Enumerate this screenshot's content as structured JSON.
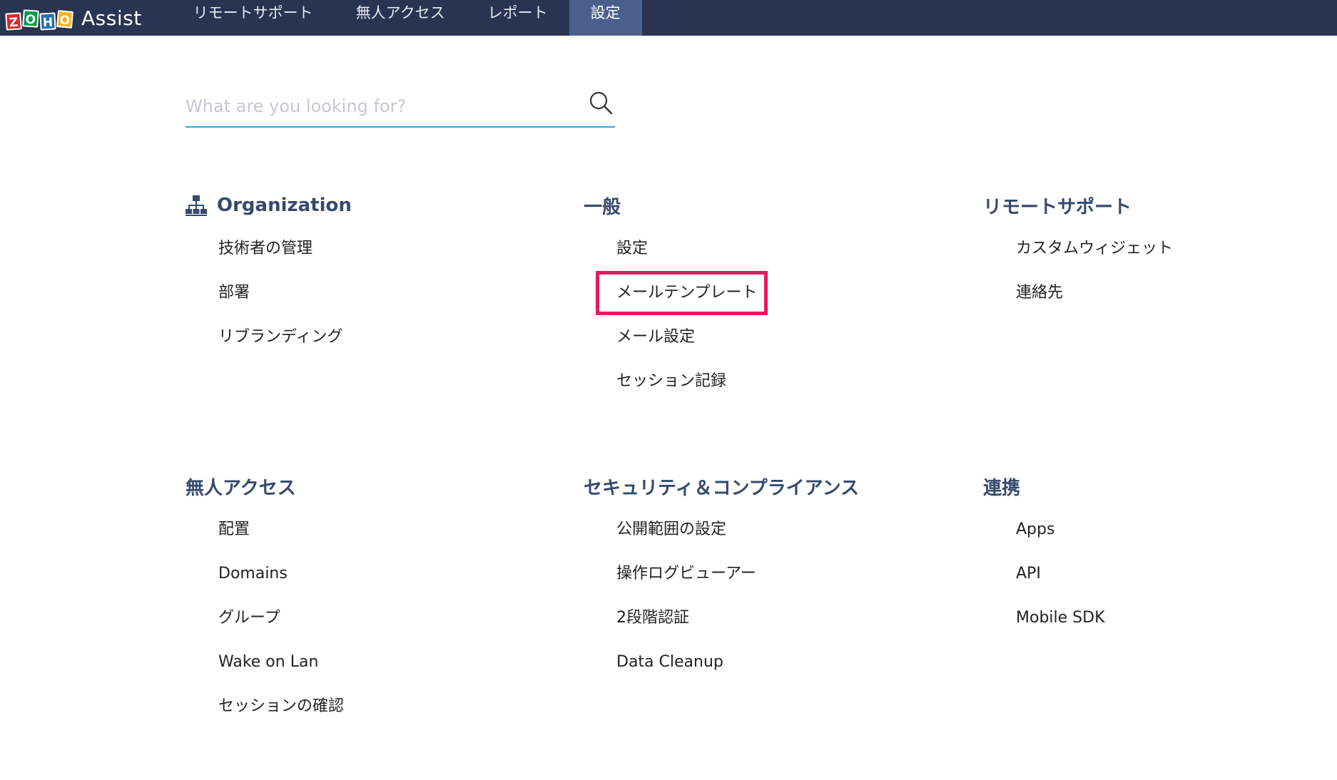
{
  "header": {
    "logo_letters": [
      "Z",
      "O",
      "H",
      "O"
    ],
    "product": "Assist",
    "tabs": [
      {
        "label": "リモートサポート",
        "active": false
      },
      {
        "label": "無人アクセス",
        "active": false
      },
      {
        "label": "レポート",
        "active": false
      },
      {
        "label": "設定",
        "active": true
      }
    ]
  },
  "search": {
    "placeholder": "What are you looking for?",
    "value": ""
  },
  "sections": {
    "organization": {
      "title": "Organization",
      "icon": "org-chart-icon",
      "items": [
        "技術者の管理",
        "部署",
        "リブランディング"
      ]
    },
    "general": {
      "title": "一般",
      "items": [
        "設定",
        "メールテンプレート",
        "メール設定",
        "セッション記録"
      ]
    },
    "remote_support": {
      "title": "リモートサポート",
      "items": [
        "カスタムウィジェット",
        "連絡先"
      ]
    },
    "unattended": {
      "title": "無人アクセス",
      "items": [
        "配置",
        "Domains",
        "グループ",
        "Wake on Lan",
        "セッションの確認"
      ]
    },
    "security": {
      "title": "セキュリティ＆コンプライアンス",
      "items": [
        "公開範囲の設定",
        "操作ログビューアー",
        "2段階認証",
        "Data Cleanup"
      ]
    },
    "integration": {
      "title": "連携",
      "items": [
        "Apps",
        "API",
        "Mobile SDK"
      ]
    }
  },
  "colors": {
    "nav_bg": "#283452",
    "nav_active": "#4a5f8c",
    "heading": "#364a6e",
    "search_underline": "#3c9de0",
    "highlight_box": "#e5195f"
  }
}
